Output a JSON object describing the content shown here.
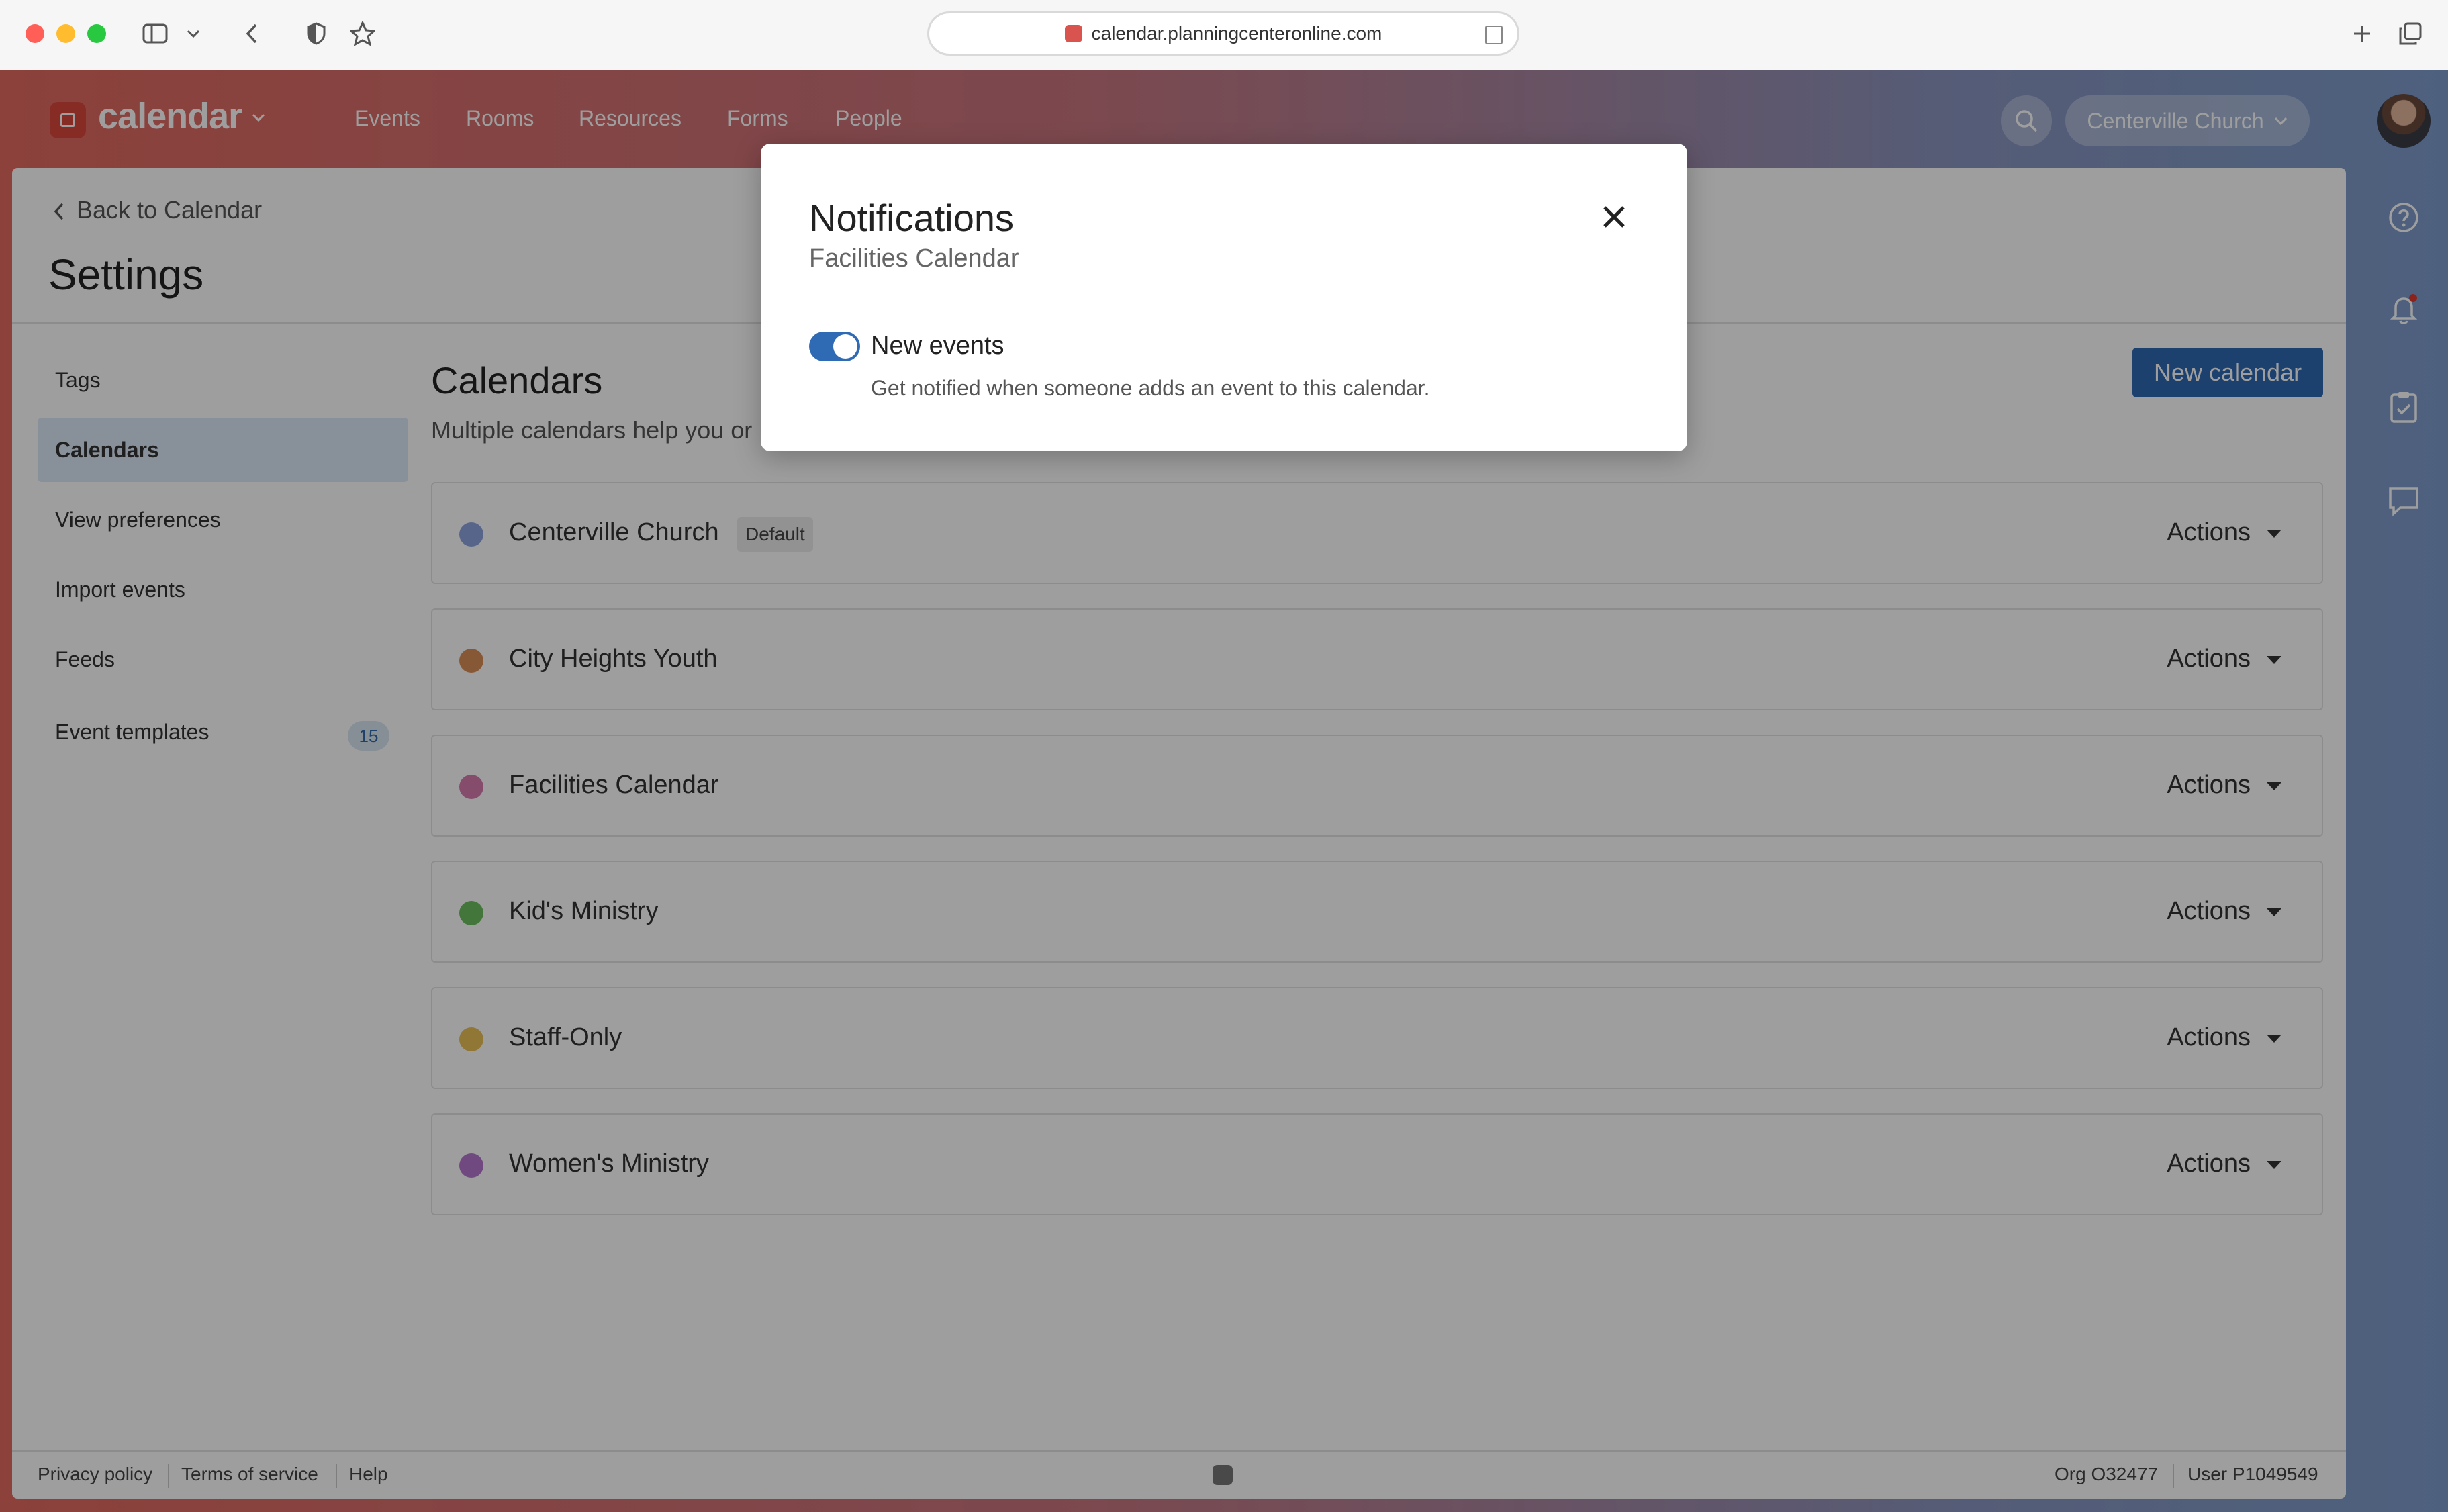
{
  "browser": {
    "url": "calendar.planningcenteronline.com"
  },
  "app": {
    "logo_text": "calendar",
    "nav": [
      "Events",
      "Rooms",
      "Resources",
      "Forms",
      "People"
    ],
    "org_name": "Centerville Church"
  },
  "settings": {
    "back_label": "Back to Calendar",
    "title": "Settings",
    "menu": [
      {
        "label": "Tags"
      },
      {
        "label": "Calendars",
        "active": true
      },
      {
        "label": "View preferences"
      },
      {
        "label": "Import events"
      },
      {
        "label": "Feeds"
      },
      {
        "label": "Event templates",
        "count": "15"
      }
    ]
  },
  "calendars": {
    "heading": "Calendars",
    "description": "Multiple calendars help you or",
    "new_button": "New calendar",
    "actions_label": "Actions",
    "default_badge": "Default",
    "rows": [
      {
        "name": "Centerville Church",
        "color": "#8fa3df",
        "is_default": true
      },
      {
        "name": "City Heights Youth",
        "color": "#d98f58"
      },
      {
        "name": "Facilities Calendar",
        "color": "#d97bad"
      },
      {
        "name": "Kid's Ministry",
        "color": "#6cbf5f"
      },
      {
        "name": "Staff-Only",
        "color": "#e8c056"
      },
      {
        "name": "Women's Ministry",
        "color": "#b577cf"
      }
    ]
  },
  "footer": {
    "privacy": "Privacy policy",
    "terms": "Terms of service",
    "help": "Help",
    "org_id": "Org O32477",
    "user_id": "User P1049549"
  },
  "modal": {
    "title": "Notifications",
    "subtitle": "Facilities Calendar",
    "toggle_label": "New events",
    "toggle_on": true,
    "toggle_help": "Get notified when someone adds an event to this calendar."
  },
  "colors": {
    "primary": "#2f6ab4",
    "brand": "#d9473d"
  }
}
